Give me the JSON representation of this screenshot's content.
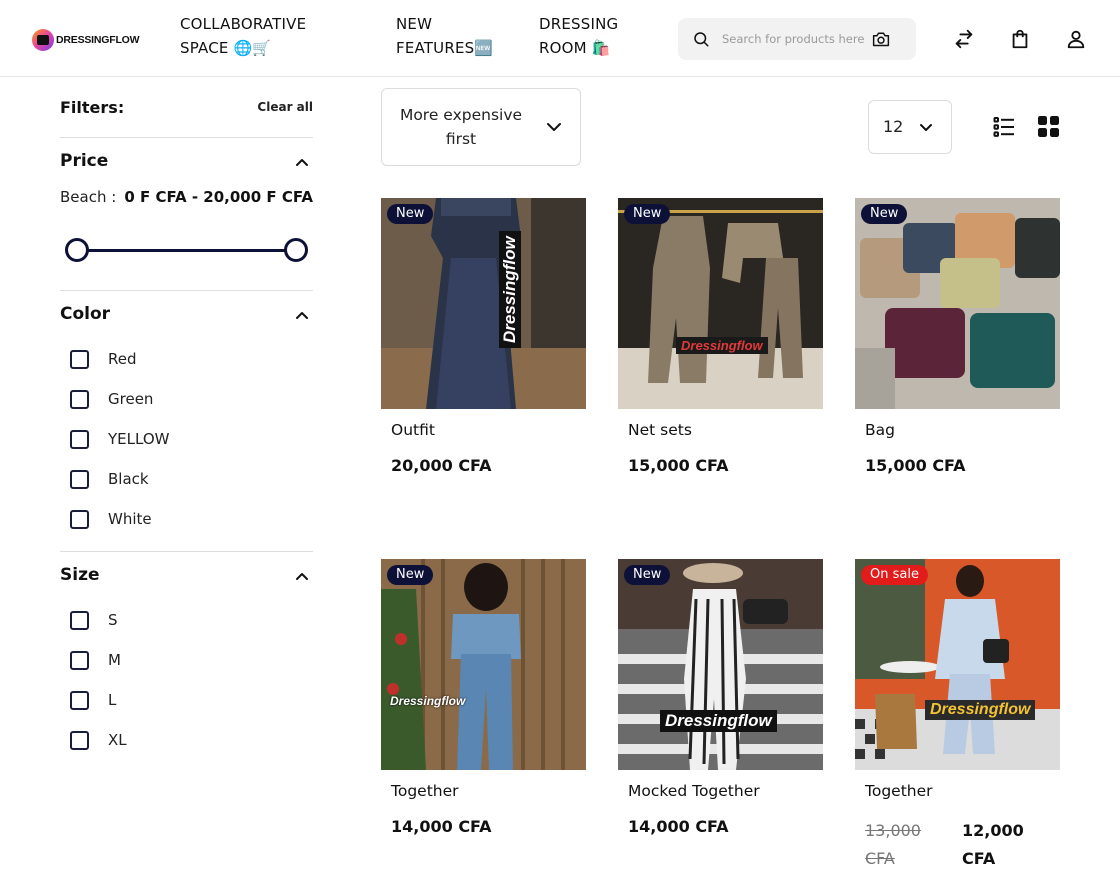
{
  "header": {
    "logo_text": "DRESSINGFLOW",
    "nav": [
      {
        "label": "COLLABORATIVE SPACE 🌐🛒"
      },
      {
        "label": "NEW FEATURES🆕"
      },
      {
        "label": "DRESSING ROOM 🛍️"
      }
    ],
    "search_placeholder": "Search for products here"
  },
  "filters": {
    "title": "Filters:",
    "clear_all": "Clear all",
    "price": {
      "title": "Price",
      "label": "Beach :",
      "range": "0 F CFA - 20,000 F CFA",
      "min_fraction": 0,
      "max_fraction": 1
    },
    "color": {
      "title": "Color",
      "options": [
        "Red",
        "Green",
        "YELLOW",
        "Black",
        "White"
      ]
    },
    "size": {
      "title": "Size",
      "options": [
        "S",
        "M",
        "L",
        "XL"
      ]
    }
  },
  "toolbar": {
    "sort_label": "More expensive first",
    "per_page": "12"
  },
  "products": [
    {
      "name": "Outfit",
      "price": "20,000 CFA",
      "badge": "New",
      "watermark": "Dressingflow"
    },
    {
      "name": "Net sets",
      "price": "15,000 CFA",
      "badge": "New",
      "watermark": "Dressingflow"
    },
    {
      "name": "Bag",
      "price": "15,000 CFA",
      "badge": "New"
    },
    {
      "name": "Together",
      "price": "14,000 CFA",
      "badge": "New",
      "watermark": "Dressingflow"
    },
    {
      "name": "Mocked Together",
      "price": "14,000 CFA",
      "badge": "New",
      "watermark": "Dressingflow"
    },
    {
      "name": "Together",
      "old_price": "13,000 CFA",
      "new_price": "12,000 CFA",
      "badge": "On sale",
      "watermark": "Dressingflow"
    }
  ],
  "colors": {
    "navy": "#0d1138",
    "sale_red": "#e21b1b",
    "search_bg": "#f2f2f2"
  }
}
